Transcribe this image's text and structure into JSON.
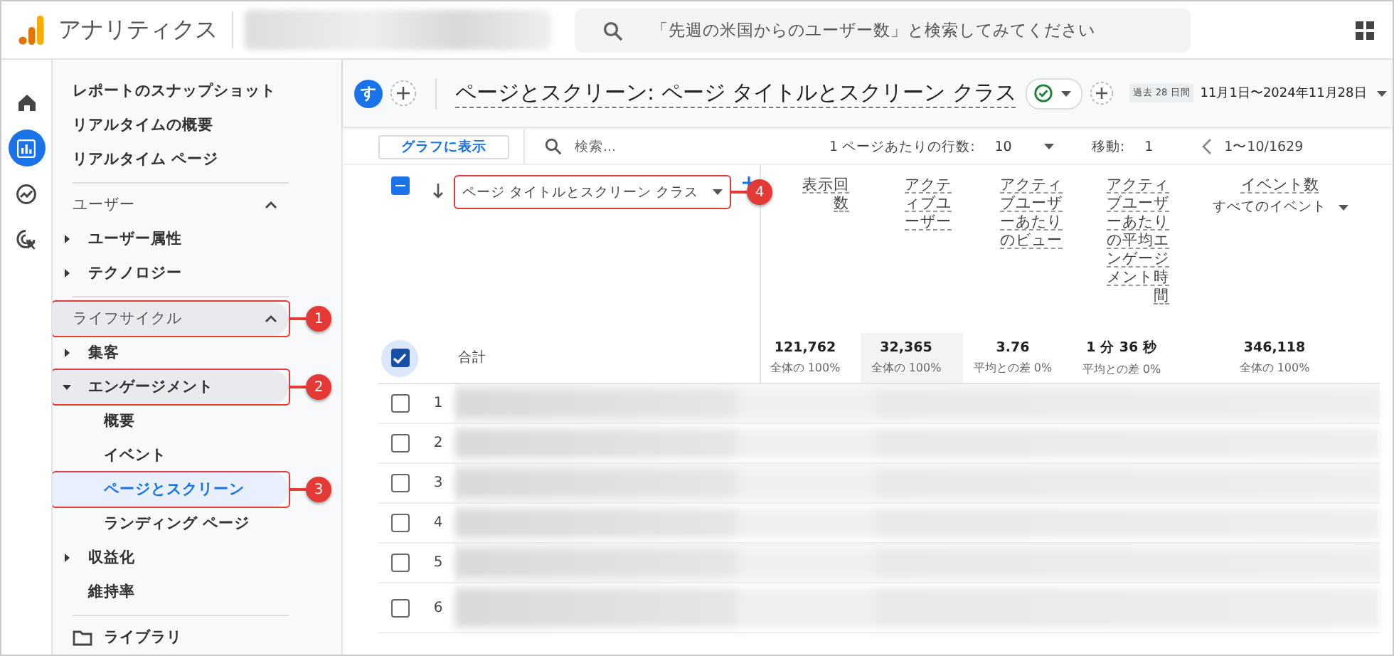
{
  "app": {
    "name": "アナリティクス",
    "search": {
      "placeholder": "「先週の米国からのユーザー数」と検索してみてください"
    }
  },
  "rail": [
    {
      "kind": "home",
      "selected": false
    },
    {
      "kind": "reports",
      "selected": true
    },
    {
      "kind": "explore",
      "selected": false
    },
    {
      "kind": "advertising",
      "selected": false
    }
  ],
  "sidebar": {
    "items": [
      {
        "kind": "link",
        "label": "レポートのスナップショット",
        "selected": false
      },
      {
        "kind": "link",
        "label": "リアルタイムの概要",
        "selected": false
      },
      {
        "kind": "link",
        "label": "リアルタイム ページ",
        "selected": false
      },
      {
        "kind": "section",
        "label": "ユーザー",
        "expanded": true,
        "highlighted": false,
        "children": [
          {
            "kind": "group",
            "label": "ユーザー属性",
            "expanded": false,
            "highlighted": false
          },
          {
            "kind": "group",
            "label": "テクノロジー",
            "expanded": false,
            "highlighted": false
          }
        ]
      },
      {
        "kind": "section",
        "label": "ライフサイクル",
        "expanded": true,
        "highlighted": true,
        "annotation": "1",
        "children": [
          {
            "kind": "group",
            "label": "集客",
            "expanded": false,
            "highlighted": false
          },
          {
            "kind": "group",
            "label": "エンゲージメント",
            "expanded": true,
            "highlighted": true,
            "annotation": "2",
            "children": [
              {
                "label": "概要",
                "selected": false
              },
              {
                "label": "イベント",
                "selected": false
              },
              {
                "label": "ページとスクリーン",
                "selected": true,
                "annotation": "3"
              },
              {
                "label": "ランディング ページ",
                "selected": false
              }
            ]
          },
          {
            "kind": "group",
            "label": "収益化",
            "expanded": false,
            "highlighted": false
          },
          {
            "kind": "link",
            "label": "維持率",
            "selected": false
          }
        ]
      },
      {
        "kind": "library",
        "label": "ライブラリ"
      }
    ]
  },
  "header": {
    "avatar": "す",
    "title": "ページとスクリーン: ページ タイトルとスクリーン クラス",
    "date_badge": "過去 28 日間",
    "date_range": "11月1日〜2024年11月28日"
  },
  "toolbar": {
    "chart_button": "グラフに表示",
    "search_placeholder": "検索...",
    "rows_label": "1 ページあたりの行数:",
    "rows_value": "10",
    "goto_label": "移動:",
    "goto_value": "1",
    "range": "1〜10/1629"
  },
  "table": {
    "header_checkbox": {
      "indeterminate": true
    },
    "dimension": {
      "label": "ページ タイトルとスクリーン クラス",
      "annotation": "4"
    },
    "columns": [
      {
        "label": "表示回数",
        "highlighted": false
      },
      {
        "label": "アクティブユーザー",
        "highlighted": true
      },
      {
        "label": "アクティブユーザーあたりのビュー",
        "highlighted": false
      },
      {
        "label": "アクティブユーザーあたりの平均エンゲージメント時間",
        "highlighted": false
      },
      {
        "label": "イベント数",
        "sublabel": "すべてのイベント",
        "highlighted": false
      }
    ],
    "totals": {
      "label": "合計",
      "checked": true,
      "values": [
        {
          "value": "121,762",
          "note": "全体の 100%"
        },
        {
          "value": "32,365",
          "note": "全体の 100%"
        },
        {
          "value": "3.76",
          "note": "平均との差 0%"
        },
        {
          "value": "1 分 36 秒",
          "note": "平均との差 0%"
        },
        {
          "value": "346,118",
          "note": "全体の 100%"
        }
      ]
    },
    "rows": [
      {
        "number": "1",
        "checked": false
      },
      {
        "number": "2",
        "checked": false
      },
      {
        "number": "3",
        "checked": false
      },
      {
        "number": "4",
        "checked": false
      },
      {
        "number": "5",
        "checked": false
      },
      {
        "number": "6",
        "checked": false
      }
    ]
  }
}
